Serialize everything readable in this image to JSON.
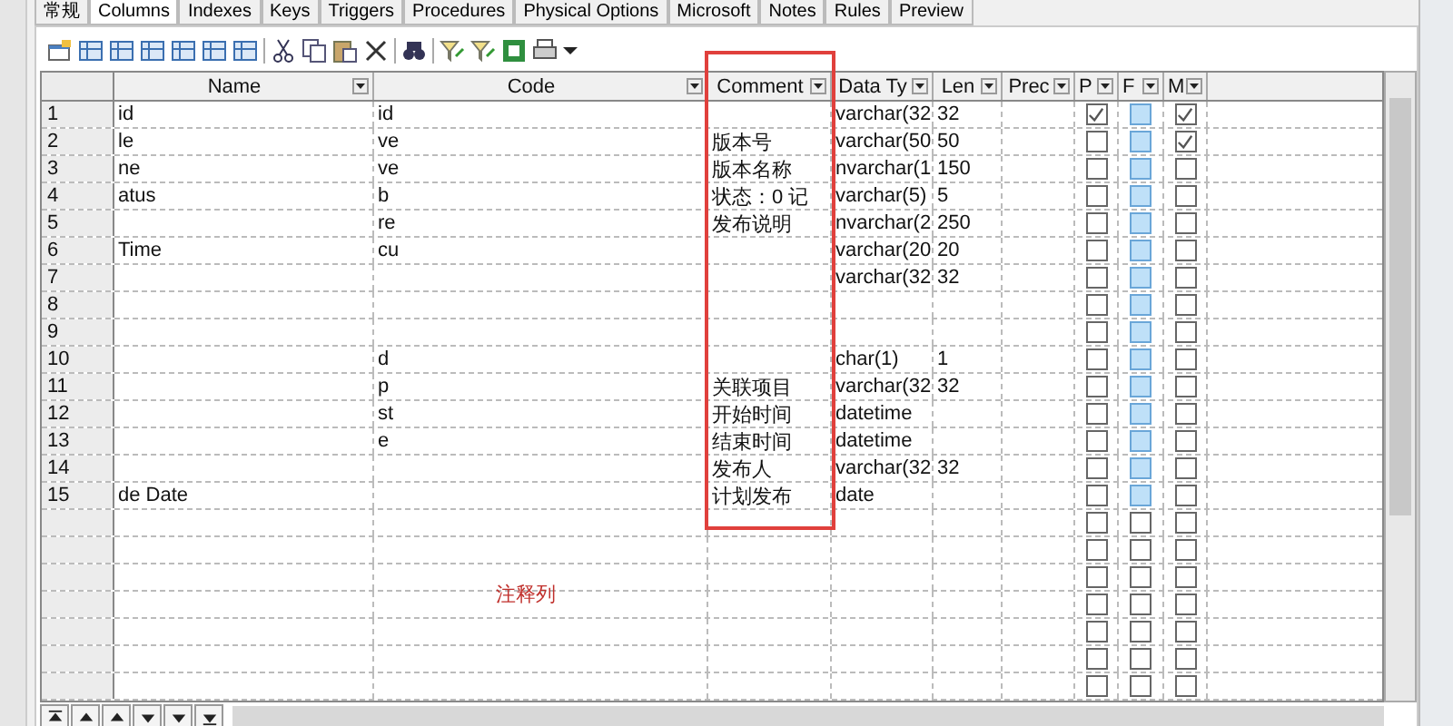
{
  "tabs": [
    {
      "label": "常规",
      "selected": false
    },
    {
      "label": "Columns",
      "selected": true
    },
    {
      "label": "Indexes",
      "selected": false
    },
    {
      "label": "Keys",
      "selected": false
    },
    {
      "label": "Triggers",
      "selected": false
    },
    {
      "label": "Procedures",
      "selected": false
    },
    {
      "label": "Physical Options",
      "selected": false
    },
    {
      "label": "Microsoft",
      "selected": false
    },
    {
      "label": "Notes",
      "selected": false
    },
    {
      "label": "Rules",
      "selected": false
    },
    {
      "label": "Preview",
      "selected": false
    }
  ],
  "columns": [
    "Name",
    "Code",
    "Comment",
    "Data Ty",
    "Len",
    "Prec",
    "P",
    "F",
    "M"
  ],
  "rows": [
    {
      "number": "1",
      "name": "id",
      "code": "id",
      "data_type": "varchar(32",
      "length": "32",
      "p": true,
      "f": true,
      "m": true
    },
    {
      "number": "2",
      "name": "le",
      "code": "ve",
      "comment": "版本号",
      "data_type": "varchar(50",
      "length": "50",
      "p": false,
      "f": true,
      "m": true
    },
    {
      "number": "3",
      "name": "ne",
      "code": "ve",
      "comment": "版本名称",
      "data_type": "nvarchar(1",
      "length": "150",
      "p": false,
      "f": true,
      "m": false
    },
    {
      "number": "4",
      "name": "atus",
      "code": "b",
      "comment": "状态：0 记",
      "data_type": "varchar(5)",
      "length": "5",
      "p": false,
      "f": true,
      "m": false
    },
    {
      "number": "5",
      "code": "re",
      "comment": "发布说明",
      "data_type": "nvarchar(2",
      "length": "250",
      "p": false,
      "f": true,
      "m": false
    },
    {
      "number": "6",
      "name": "Time",
      "code": "cu",
      "data_type": "varchar(20",
      "length": "20",
      "p": false,
      "f": true,
      "m": false
    },
    {
      "number": "7",
      "data_type": "varchar(32",
      "length": "32",
      "p": false,
      "f": true,
      "m": false
    },
    {
      "number": "8",
      "p": false,
      "f": true,
      "m": false
    },
    {
      "number": "9",
      "p": false,
      "f": true,
      "m": false
    },
    {
      "number": "10",
      "code": "d",
      "data_type": "char(1)",
      "length": "1",
      "p": false,
      "f": true,
      "m": false
    },
    {
      "number": "11",
      "code": "p",
      "comment": "关联项目",
      "data_type": "varchar(32",
      "length": "32",
      "p": false,
      "f": true,
      "m": false
    },
    {
      "number": "12",
      "code": "st",
      "comment": "开始时间",
      "data_type": "datetime",
      "p": false,
      "f": true,
      "m": false
    },
    {
      "number": "13",
      "code": "e",
      "comment": "结束时间",
      "data_type": "datetime",
      "p": false,
      "f": true,
      "m": false
    },
    {
      "number": "14",
      "comment": "发布人",
      "data_type": "varchar(32",
      "length": "32",
      "p": false,
      "f": true,
      "m": false
    },
    {
      "number": "15",
      "name": "de Date",
      "comment": "计划发布",
      "data_type": "date",
      "p": false,
      "f": true,
      "m": false
    },
    {
      "p": false,
      "f": false,
      "m": false
    },
    {
      "p": false,
      "f": false,
      "m": false
    },
    {
      "p": false,
      "f": false,
      "m": false
    },
    {
      "p": false,
      "f": false,
      "m": false
    },
    {
      "p": false,
      "f": false,
      "m": false
    },
    {
      "p": false,
      "f": false,
      "m": false
    },
    {
      "p": false,
      "f": false,
      "m": false
    }
  ],
  "annotation": "注释列"
}
